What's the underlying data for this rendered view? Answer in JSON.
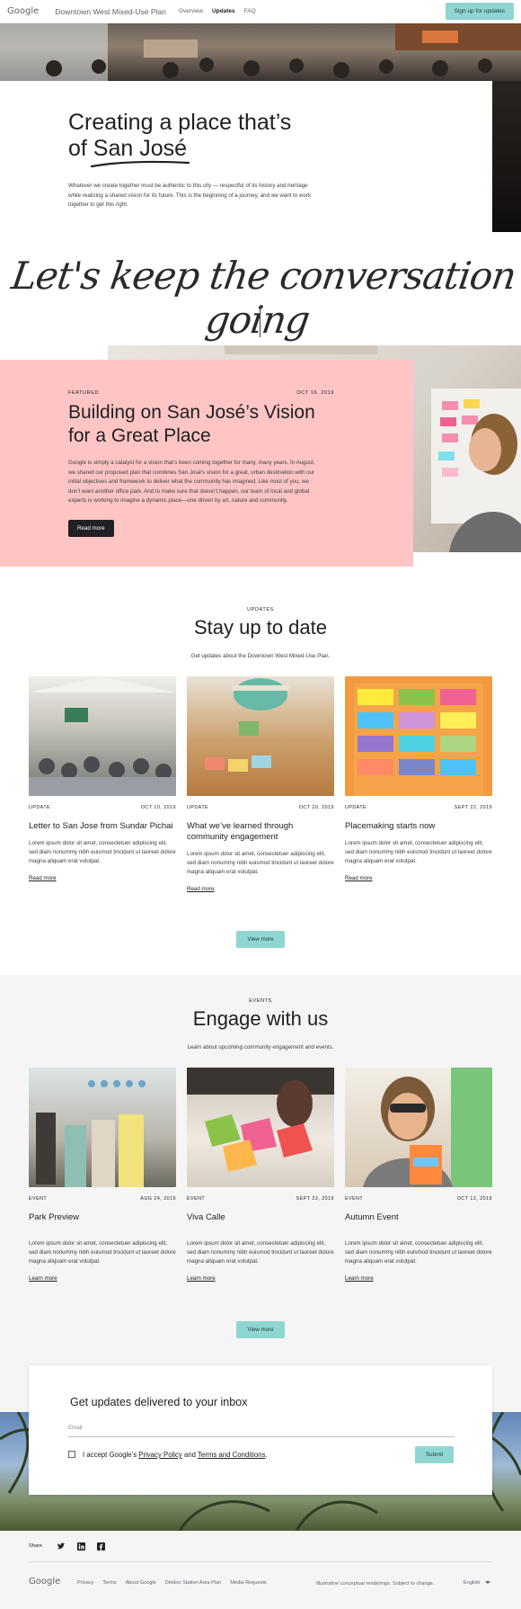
{
  "header": {
    "logo": "Google",
    "site_title": "Downtown West Mixed-Use Plan",
    "nav": [
      "Overview",
      "Updates",
      "FAQ"
    ],
    "active_nav": "Updates",
    "cta": "Sign up for updates"
  },
  "hero": {
    "title_line1": "Creating a place that’s",
    "title_line2_prefix": "of ",
    "title_line2_highlight": "San José",
    "body": "Whatever we create together must be authentic to this city — respectful of its history and heritage while realizing a shared vision for its future. This is the beginning of a journey, and we want to keep the conversation going.",
    "body_lines": [
      "Whatever we create together must be authentic to this city — respectful of its history and heritage",
      "while realizing a shared vision for its future. This is the beginning of a journey, and we want to work",
      "together to get this right."
    ]
  },
  "script_heading": "Let's keep the conversation going",
  "featured": {
    "eyebrow": "FEATURED",
    "date": "OCT 16, 2019",
    "title_line1": "Building on San José’s Vision",
    "title_line2": "for a Great Place",
    "body_lines": [
      "Google is simply a catalyst for a vision that’s been coming together for many, many years. In August,",
      "we shared our proposed plan that combines San José’s vision for a great, urban destination with our",
      "initial objectives and framework to deliver what the community has imagined. Like most of you, we",
      "don’t want another office park. And to make sure that doesn’t happen, our team of local and global",
      "experts is working to imagine a dynamic place—one driven by art, nature and community."
    ],
    "button": "Read more"
  },
  "updates": {
    "eyebrow": "UPDATES",
    "title": "Stay up to date",
    "subtitle": "Get updates about the Downtown West Mixed-Use Plan.",
    "cards": [
      {
        "tag": "UPDATE",
        "date": "OCT 10, 2019",
        "title": "Letter to San Jose from Sundar Pichai",
        "body": "Lorem ipsum dolor sit amet, consectetuer adipiscing elit, sed diam nonummy nibh euismod tincidunt ut laoreet dolore magna aliquam erat volutpat.",
        "link": "Read more"
      },
      {
        "tag": "UPDATE",
        "date": "OCT 20, 2019",
        "title": "What we’ve learned through community engagement",
        "body": "Lorem ipsum dolor sit amet, consectetuer adipiscing elit, sed diam nonummy nibh euismod tincidunt ut laoreet dolore magna aliquam erat volutpat.",
        "link": "Read more"
      },
      {
        "tag": "UPDATE",
        "date": "SEPT 22, 2019",
        "title": "Placemaking starts now",
        "body": "Lorem ipsum dolor sit amet, consectetuer adipiscing elit, sed diam nonummy nibh euismod tincidunt ut laoreet dolore magna aliquam erat volutpat.",
        "link": "Read more"
      }
    ],
    "button": "View more"
  },
  "events": {
    "eyebrow": "EVENTS",
    "title": "Engage with us",
    "subtitle": "Learn about upcoming community engagement and events.",
    "cards": [
      {
        "tag": "EVENT",
        "date": "AUG 24, 2019",
        "title": "Park Preview",
        "body": "Lorem ipsum dolor sit amet, consectetuer adipiscing elit, sed diam nonummy nibh euismod tincidunt ut laoreet dolore magna aliquam erat volutpat.",
        "link": "Learn more"
      },
      {
        "tag": "EVENT",
        "date": "SEPT 22, 2019",
        "title": "Viva Calle",
        "body": "Lorem ipsum dolor sit amet, consectetuer adipiscing elit, sed diam nonummy nibh euismod tincidunt ut laoreet dolore magna aliquam erat volutpat.",
        "link": "Learn more"
      },
      {
        "tag": "EVENT",
        "date": "OCT 12, 2019",
        "title": "Autumn Event",
        "body": "Lorem ipsum dolor sit amet, consectetuer adipiscing elit, sed diam nonummy nibh euismod tincidunt ut laoreet dolore magna aliquam erat volutpat.",
        "link": "Learn more"
      }
    ],
    "button": "View more"
  },
  "newsletter": {
    "title": "Get updates delivered to your inbox",
    "email_placeholder": "Email",
    "consent_prefix": "I accept Google’s ",
    "privacy": "Privacy Policy",
    "consent_mid": " and ",
    "terms": "Terms and Conditions",
    "consent_suffix": ".",
    "submit": "Submit"
  },
  "footer": {
    "share_label": "Share",
    "logo": "Google",
    "links": [
      "Privacy",
      "Terms",
      "About Google",
      "Diridon Station Area Plan",
      "Media Requests"
    ],
    "note": "Illustrative conceptual renderings. Subject to change.",
    "language": "English"
  },
  "colors": {
    "accent": "#8fd6d2",
    "featured_bg": "#ffc5c4",
    "dark": "#202124",
    "section_bg": "#f5f5f6"
  }
}
